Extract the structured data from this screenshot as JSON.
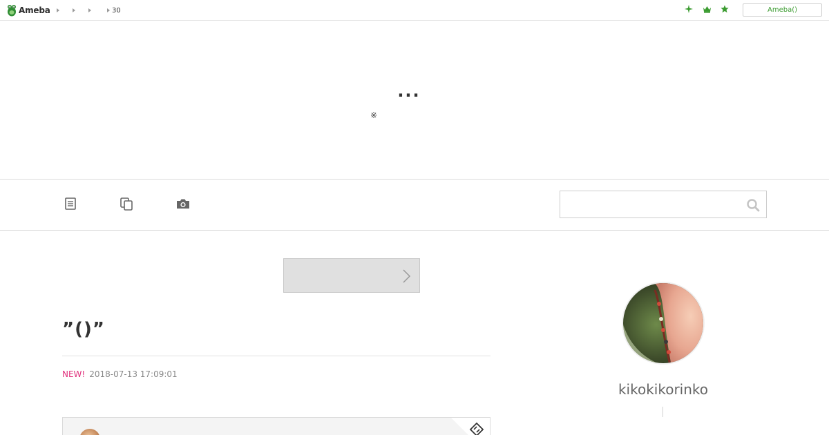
{
  "header": {
    "logo_text": "Ameba",
    "breadcrumbs": [
      {
        "label": ""
      },
      {
        "label": ""
      },
      {
        "label": ""
      },
      {
        "label": "30"
      }
    ],
    "icons": [
      "sparkle-icon",
      "crown-icon",
      "star-icon"
    ],
    "account_button": "Ameba()"
  },
  "blog": {
    "title": "...",
    "subtitle": "※"
  },
  "nav": {
    "icons": [
      "document-icon",
      "copy-icon",
      "camera-icon"
    ],
    "search_placeholder": ""
  },
  "entry": {
    "prev_label": "",
    "title": "”()”",
    "new_badge": "NEW!",
    "date": "2018-07-13 17:09:01"
  },
  "profile": {
    "name": "kikokikorinko"
  },
  "colors": {
    "brand_green": "#3a9b2f",
    "new_pink": "#e0327d"
  }
}
